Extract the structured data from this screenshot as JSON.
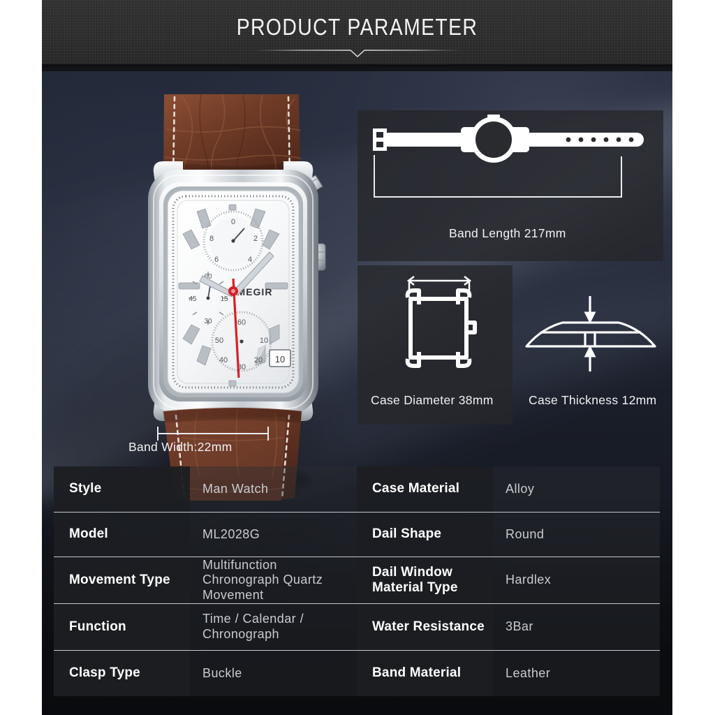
{
  "header": {
    "title": "PRODUCT PARAMETER",
    "divider_icon": "chevron-down-divider"
  },
  "product": {
    "brand_on_dial": "MEGIR",
    "photo_description": "silver rectangular chronograph watch with brown crocodile-pattern leather strap",
    "dial_subdials": {
      "top": [
        "0",
        "2",
        "4",
        "6",
        "8"
      ],
      "left": [
        "45",
        "15",
        "30"
      ],
      "bottom": [
        "10",
        "20",
        "30",
        "40",
        "50"
      ]
    },
    "second_hand_color": "#d81f26",
    "case_color": "#e8eaec",
    "strap_color": "#6b3b26"
  },
  "diagrams": [
    {
      "name": "band-length",
      "icon": "watch-flat-silhouette-icon",
      "label": "Band Length 217mm",
      "value": "217mm"
    },
    {
      "name": "case-diameter",
      "icon": "case-front-outline-icon",
      "label": "Case Diameter 38mm",
      "value": "38mm"
    },
    {
      "name": "case-thickness",
      "icon": "case-side-profile-icon",
      "label": "Case Thickness 12mm",
      "value": "12mm"
    },
    {
      "name": "band-width",
      "icon": "dimension-bracket-icon",
      "label": "Band Width:22mm",
      "value": "22mm"
    }
  ],
  "spec_table": {
    "rows": [
      {
        "label_left": "Style",
        "value_left": "Man Watch",
        "label_right": "Case Material",
        "value_right": "Alloy"
      },
      {
        "label_left": "Model",
        "value_left": "ML2028G",
        "label_right": "Dail Shape",
        "value_right": "Round"
      },
      {
        "label_left": "Movement Type",
        "value_left": "Multifunction Chronograph Quartz Movement",
        "label_right": "Dail Window Material Type",
        "value_right": "Hardlex"
      },
      {
        "label_left": "Function",
        "value_left": "Time  / Calendar / Chronograph",
        "label_right": "Water Resistance",
        "value_right": "3Bar"
      },
      {
        "label_left": "Clasp Type",
        "value_left": "Buckle",
        "label_right": "Band Material",
        "value_right": "Leather"
      }
    ]
  },
  "colors": {
    "header_bg": "#2c2c2c",
    "canvas_bg": "#121418",
    "photo_bg": "#1b2130",
    "label_cell_bg": "#1c1e22",
    "value_text": "#c9cbd0",
    "line": "#e8eaee",
    "page_margin": "#ffffff"
  }
}
